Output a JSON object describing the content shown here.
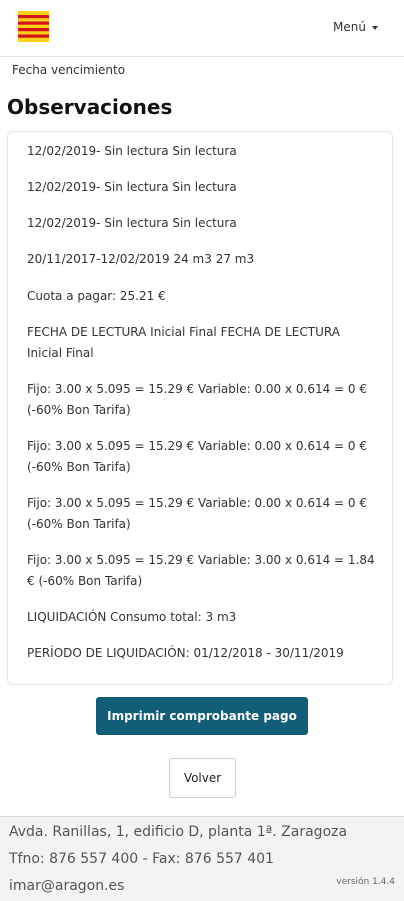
{
  "header": {
    "menu_label": "Menú"
  },
  "fecha_label": "Fecha vencimiento",
  "observaciones": {
    "title": "Observaciones",
    "items": [
      "12/02/2019- Sin lectura Sin lectura",
      "12/02/2019- Sin lectura Sin lectura",
      "12/02/2019- Sin lectura Sin lectura",
      "20/11/2017-12/02/2019 24 m3 27 m3",
      "Cuota a pagar: 25.21 €",
      "FECHA DE LECTURA Inicial Final FECHA DE LECTURA Inicial Final",
      "Fijo: 3.00 x 5.095 = 15.29 € Variable: 0.00 x 0.614 = 0 € (-60% Bon Tarifa)",
      "Fijo: 3.00 x 5.095 = 15.29 € Variable: 0.00 x 0.614 = 0 € (-60% Bon Tarifa)",
      "Fijo: 3.00 x 5.095 = 15.29 € Variable: 0.00 x 0.614 = 0 € (-60% Bon Tarifa)",
      "Fijo: 3.00 x 5.095 = 15.29 € Variable: 3.00 x 0.614 = 1.84 € (-60% Bon Tarifa)",
      "LIQUIDACIÓN Consumo total: 3 m3",
      "PERÍODO DE LIQUIDACIÓN: 01/12/2018 - 30/11/2019"
    ]
  },
  "buttons": {
    "print_label": "Imprimir comprobante pago",
    "back_label": "Volver"
  },
  "footer": {
    "address": "Avda. Ranillas, 1, edificio D, planta 1ª. Zaragoza",
    "phone": "Tfno: 876 557 400 - Fax: 876 557 401",
    "email": "imar@aragon.es",
    "version": "versión 1.4.4"
  },
  "colors": {
    "primary_button": "#125d78",
    "flag_yellow": "#fcd116",
    "flag_red": "#d5121e"
  },
  "icons": {
    "logo": "aragon-flag-logo",
    "menu_caret": "caret-down-icon"
  }
}
